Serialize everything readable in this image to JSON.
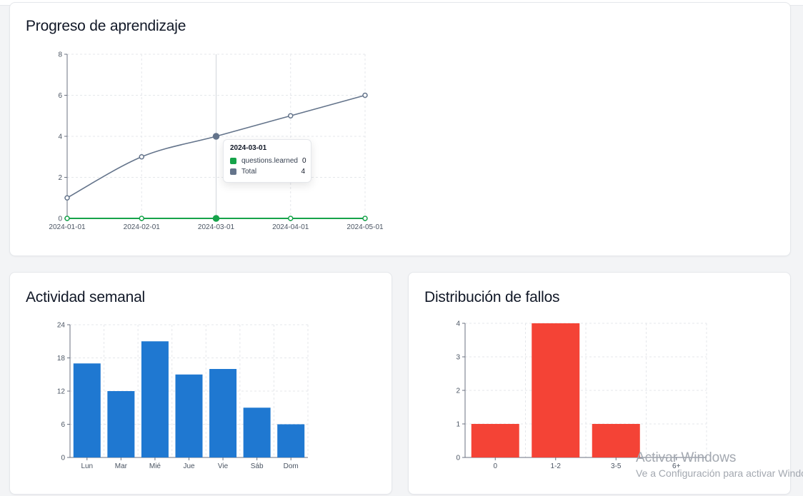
{
  "colors": {
    "learned": "#16a34a",
    "total": "#64748b",
    "weekly": "#1f78d1",
    "failures": "#f44336"
  },
  "progress": {
    "title": "Progreso de aprendizaje",
    "tooltip": {
      "date": "2024-03-01",
      "rows": [
        {
          "name": "questions.learned",
          "value": "0"
        },
        {
          "name": "Total",
          "value": "4"
        }
      ]
    }
  },
  "weekly": {
    "title": "Actividad semanal"
  },
  "failures": {
    "title": "Distribución de fallos"
  },
  "watermark": {
    "title": "Activar Windows",
    "subtitle": "Ve a Configuración para activar Windows."
  },
  "chart_data": [
    {
      "type": "line",
      "title": "Progreso de aprendizaje",
      "x": [
        "2024-01-01",
        "2024-02-01",
        "2024-03-01",
        "2024-04-01",
        "2024-05-01"
      ],
      "series": [
        {
          "name": "questions.learned",
          "values": [
            0,
            0,
            0,
            0,
            0
          ]
        },
        {
          "name": "Total",
          "values": [
            1,
            3,
            4,
            5,
            6
          ]
        }
      ],
      "ylim": [
        0,
        8
      ],
      "yticks": [
        0,
        2,
        4,
        6,
        8
      ],
      "grid": true
    },
    {
      "type": "bar",
      "title": "Actividad semanal",
      "categories": [
        "Lun",
        "Mar",
        "Mié",
        "Jue",
        "Vie",
        "Sáb",
        "Dom"
      ],
      "values": [
        17,
        12,
        21,
        15,
        16,
        9,
        6
      ],
      "ylim": [
        0,
        24
      ],
      "yticks": [
        0,
        6,
        12,
        18,
        24
      ],
      "grid": true
    },
    {
      "type": "bar",
      "title": "Distribución de fallos",
      "categories": [
        "0",
        "1-2",
        "3-5",
        "6+"
      ],
      "values": [
        1,
        4,
        1,
        0
      ],
      "ylim": [
        0,
        4
      ],
      "yticks": [
        0,
        1,
        2,
        3,
        4
      ],
      "grid": true
    }
  ]
}
